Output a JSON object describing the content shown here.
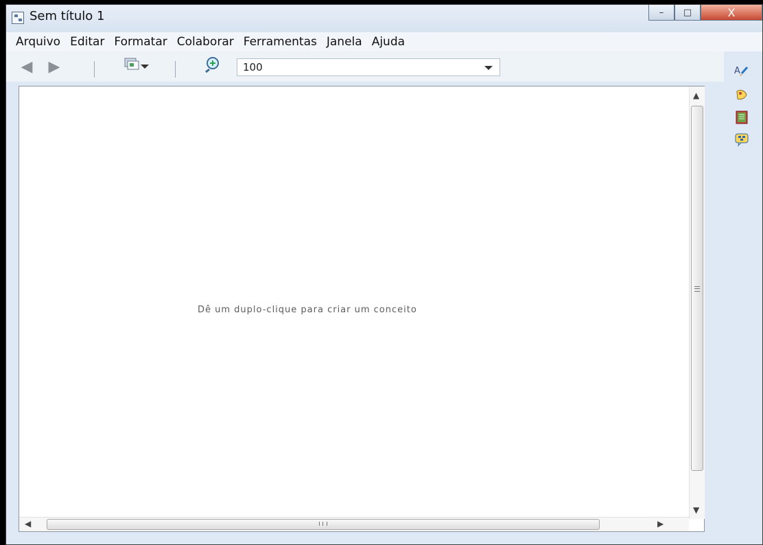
{
  "window": {
    "title": "Sem título 1",
    "controls": {
      "minimize": "–",
      "maximize": "□",
      "close": "X"
    }
  },
  "menu": {
    "items": [
      "Arquivo",
      "Editar",
      "Formatar",
      "Colaborar",
      "Ferramentas",
      "Janela",
      "Ajuda"
    ]
  },
  "toolbar": {
    "zoom_value": "100"
  },
  "canvas": {
    "hint": "Dê um duplo-clique para criar um conceito"
  },
  "icons": {
    "app": "cmap-app-icon",
    "back": "back-arrow-icon",
    "forward": "forward-arrow-icon",
    "view": "view-options-icon",
    "zoom": "zoom-icon",
    "side_1": "styles-icon",
    "side_2": "paint-icon",
    "side_3": "book-icon",
    "side_4": "discussion-icon"
  }
}
